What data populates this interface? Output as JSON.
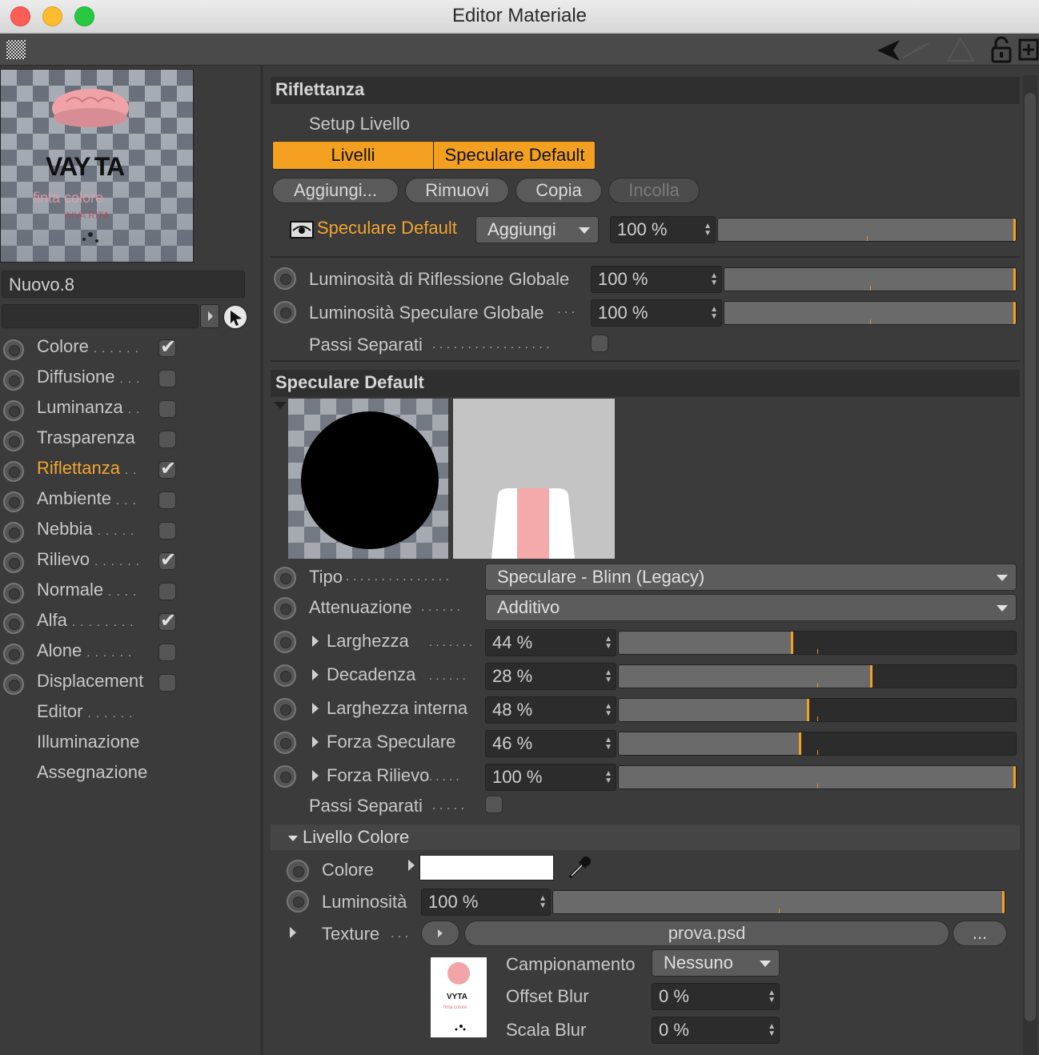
{
  "window": {
    "title": "Editor Materiale"
  },
  "material": {
    "name": "Nuovo.8"
  },
  "channels": [
    {
      "label": "Colore",
      "dots": ". . . . . .",
      "checked": true,
      "active": false,
      "has_check": true
    },
    {
      "label": "Diffusione",
      "dots": ". . .",
      "checked": false,
      "active": false,
      "has_check": true
    },
    {
      "label": "Luminanza",
      "dots": ". .",
      "checked": false,
      "active": false,
      "has_check": true
    },
    {
      "label": "Trasparenza",
      "dots": "",
      "checked": false,
      "active": false,
      "has_check": true
    },
    {
      "label": "Riflettanza",
      "dots": ". .",
      "checked": true,
      "active": true,
      "has_check": true
    },
    {
      "label": "Ambiente",
      "dots": ". . .",
      "checked": false,
      "active": false,
      "has_check": true
    },
    {
      "label": "Nebbia",
      "dots": ". . . . .",
      "checked": false,
      "active": false,
      "has_check": true
    },
    {
      "label": "Rilievo",
      "dots": ". . . . . .",
      "checked": true,
      "active": false,
      "has_check": true
    },
    {
      "label": "Normale",
      "dots": ". . . .",
      "checked": false,
      "active": false,
      "has_check": true
    },
    {
      "label": "Alfa",
      "dots": ". . . . . . . .",
      "checked": true,
      "active": false,
      "has_check": true
    },
    {
      "label": "Alone",
      "dots": ". . . . . .",
      "checked": false,
      "active": false,
      "has_check": true
    },
    {
      "label": "Displacement",
      "dots": "",
      "checked": false,
      "active": false,
      "has_check": true
    },
    {
      "label": "Editor",
      "dots": ". . . . . .",
      "checked": false,
      "active": false,
      "has_check": false
    },
    {
      "label": "Illuminazione",
      "dots": "",
      "checked": false,
      "active": false,
      "has_check": false
    },
    {
      "label": "Assegnazione",
      "dots": "",
      "checked": false,
      "active": false,
      "has_check": false
    }
  ],
  "reflectance": {
    "header": "Riflettanza",
    "setup_label": "Setup Livello",
    "layer_tabs": [
      "Livelli",
      "Speculare Default"
    ],
    "buttons": {
      "add": "Aggiungi...",
      "remove": "Rimuovi",
      "copy": "Copia",
      "paste": "Incolla"
    },
    "layer_row": {
      "name": "Speculare Default",
      "mode": "Aggiungi",
      "value": "100 %",
      "fill": 1.0
    },
    "global_reflection": {
      "label": "Luminosità di Riflessione Globale",
      "value": "100 %",
      "fill": 1.0
    },
    "global_specular": {
      "label": "Luminosità Speculare Globale",
      "dots": ". . .",
      "value": "100 %",
      "fill": 1.0
    },
    "separate_passes": {
      "label": "Passi Separati",
      "dots": ". . . . . . . . . . . . . . . . ."
    }
  },
  "specular": {
    "header": "Speculare Default",
    "tipo": {
      "label": "Tipo",
      "dots": ". . . . . . . . . . . . . . .",
      "value": "Speculare - Blinn (Legacy)"
    },
    "attenuazione": {
      "label": "Attenuazione",
      "dots": ". . . . . .",
      "value": "Additivo"
    },
    "params": [
      {
        "label": "Larghezza",
        "dots": ". . . . . . .",
        "value": "44 %",
        "fill": 0.44
      },
      {
        "label": "Decadenza",
        "dots": ". . . . . .",
        "value": "28 %",
        "fill": 0.64
      },
      {
        "label": "Larghezza interna",
        "dots": "",
        "value": "48 %",
        "fill": 0.48
      },
      {
        "label": "Forza Speculare",
        "dots": "",
        "value": "46 %",
        "fill": 0.46
      },
      {
        "label": "Forza Rilievo",
        "dots": ". . . . .",
        "value": "100 %",
        "fill": 1.0
      }
    ],
    "separate_passes": {
      "label": "Passi Separati",
      "dots": ". . . . ."
    }
  },
  "color_layer": {
    "header": "Livello Colore",
    "color_label": "Colore",
    "color_value": "#ffffff",
    "brightness_label": "Luminosità",
    "brightness_value": "100 %",
    "brightness_fill": 1.0,
    "texture_label": "Texture",
    "texture_dots": ". . .",
    "texture_file": "prova.psd",
    "more_button": "...",
    "sampling_label": "Campionamento",
    "sampling_value": "Nessuno",
    "offset_blur_label": "Offset Blur",
    "offset_blur_value": "0 %",
    "scale_blur_label": "Scala Blur",
    "scale_blur_value": "0 %"
  },
  "colors": {
    "accent": "#f3a020",
    "active_text": "#f3a530",
    "panel": "#3b3b3b"
  },
  "icons": [
    "grid-icon",
    "arrow-back-icon",
    "lock-icon",
    "new-window-icon",
    "eye-icon",
    "eyedropper-icon",
    "cursor-icon",
    "play-icon"
  ]
}
